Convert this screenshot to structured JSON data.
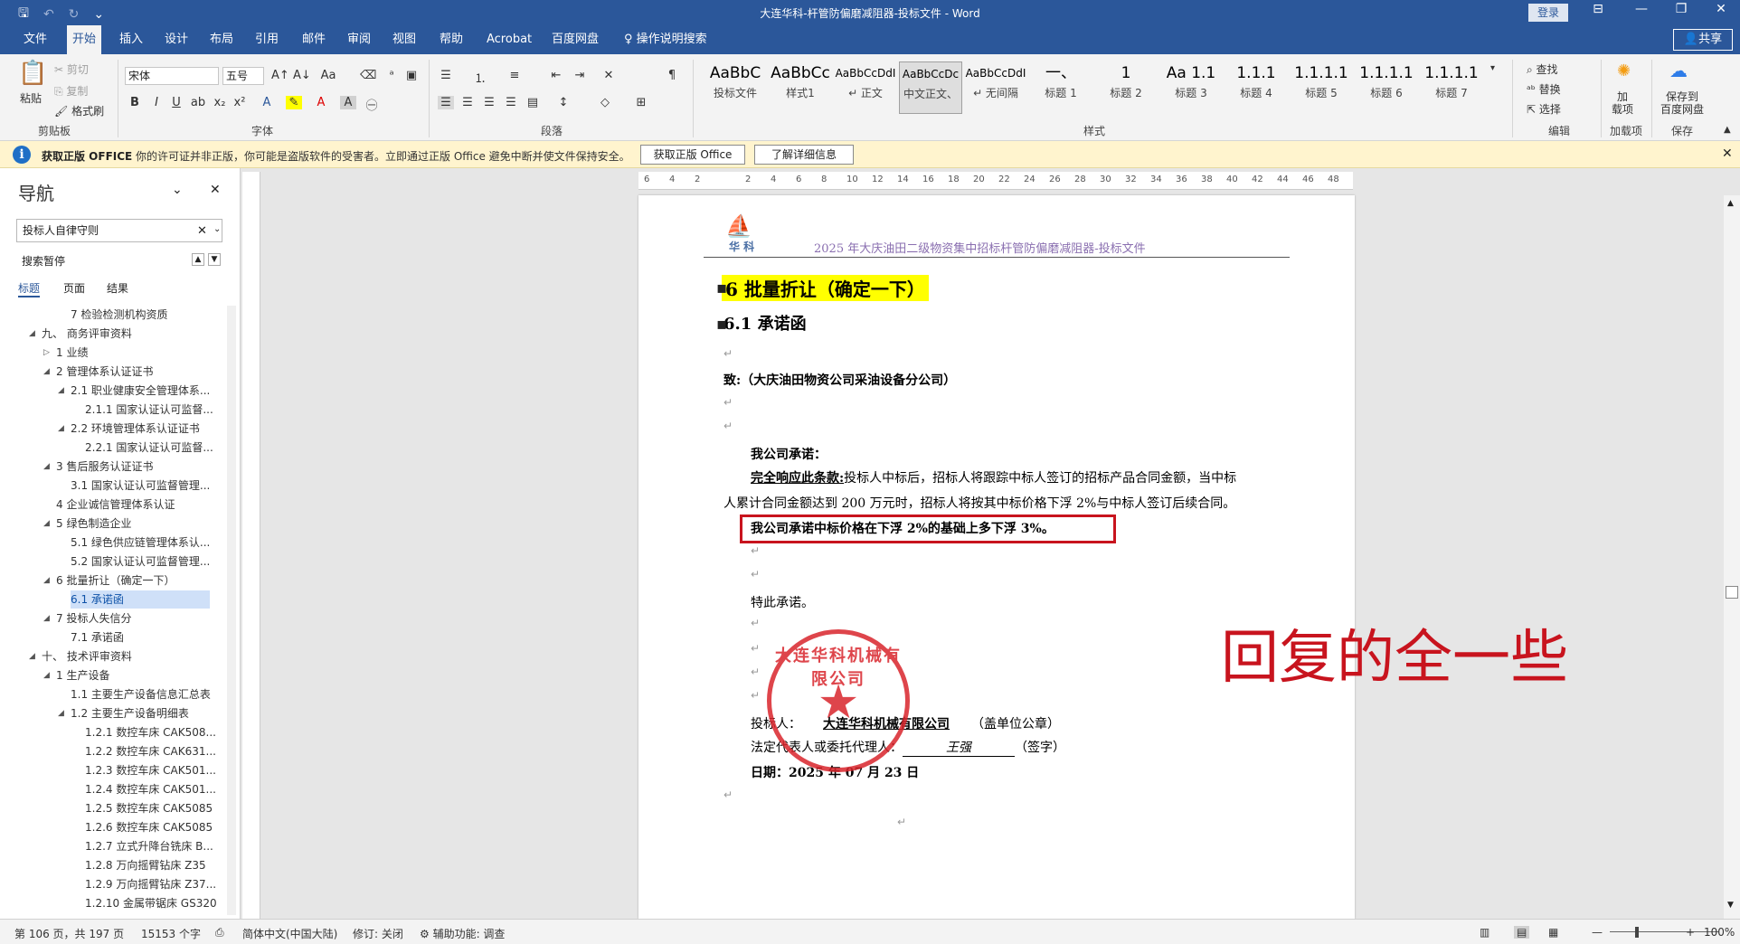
{
  "title_bar": {
    "title": "大连华科-杆管防偏磨减阻器-投标文件  -  Word",
    "login": "登录"
  },
  "tabs": [
    "文件",
    "开始",
    "插入",
    "设计",
    "布局",
    "引用",
    "邮件",
    "审阅",
    "视图",
    "帮助",
    "Acrobat",
    "百度网盘",
    "操作说明搜索"
  ],
  "active_tab": "开始",
  "share_label": "共享",
  "ribbon": {
    "clipboard": {
      "paste": "粘贴",
      "cut": "剪切",
      "copy": "复制",
      "format_painter": "格式刷",
      "label": "剪贴板"
    },
    "font": {
      "font_name": "宋体",
      "font_size": "五号",
      "label": "字体"
    },
    "paragraph": {
      "label": "段落"
    },
    "styles": {
      "label": "样式",
      "items": [
        {
          "sample": "AaBbC",
          "name": "投标文件"
        },
        {
          "sample": "AaBbCc",
          "name": "样式1"
        },
        {
          "sample": "AaBbCcDdI",
          "name": "↵ 正文"
        },
        {
          "sample": "AaBbCcDc",
          "name": "中文正文、"
        },
        {
          "sample": "AaBbCcDdI",
          "name": "↵ 无间隔"
        },
        {
          "sample": "一、",
          "name": "标题 1"
        },
        {
          "sample": "1",
          "name": "标题 2"
        },
        {
          "sample": "Aa 1.1",
          "name": "标题 3"
        },
        {
          "sample": "1.1.1",
          "name": "标题 4"
        },
        {
          "sample": "1.1.1.1",
          "name": "标题 5"
        },
        {
          "sample": "1.1.1.1",
          "name": "标题 6"
        },
        {
          "sample": "1.1.1.1",
          "name": "标题 7"
        }
      ]
    },
    "editing": {
      "find": "查找",
      "replace": "替换",
      "select": "选择",
      "label": "编辑"
    },
    "addins": {
      "item": "加\n载项",
      "label": "加载项"
    },
    "save": {
      "item": "保存到\n百度网盘",
      "label": "保存"
    }
  },
  "info_bar": {
    "heading": "获取正版 OFFICE",
    "message": "你的许可证并非正版，你可能是盗版软件的受害者。立即通过正版 Office 避免中断并使文件保持安全。",
    "button1": "获取正版 Office",
    "button2": "了解详细信息"
  },
  "nav": {
    "title": "导航",
    "search_value": "投标人自律守则",
    "paused": "搜索暂停",
    "tabs": [
      "标题",
      "页面",
      "结果"
    ],
    "items": [
      {
        "text": "7 检验检测机构资质",
        "indent": 3,
        "toggle": ""
      },
      {
        "text": "九、 商务评审资料",
        "indent": 1,
        "toggle": "◢"
      },
      {
        "text": "1 业绩",
        "indent": 2,
        "toggle": "▷"
      },
      {
        "text": "2 管理体系认证证书",
        "indent": 2,
        "toggle": "◢"
      },
      {
        "text": "2.1 职业健康安全管理体系...",
        "indent": 3,
        "toggle": "◢"
      },
      {
        "text": "2.1.1 国家认证认可监督...",
        "indent": 4,
        "toggle": ""
      },
      {
        "text": "2.2 环境管理体系认证证书",
        "indent": 3,
        "toggle": "◢"
      },
      {
        "text": "2.2.1 国家认证认可监督...",
        "indent": 4,
        "toggle": ""
      },
      {
        "text": "3 售后服务认证证书",
        "indent": 2,
        "toggle": "◢"
      },
      {
        "text": "3.1 国家认证认可监督管理...",
        "indent": 3,
        "toggle": ""
      },
      {
        "text": "4 企业诚信管理体系认证",
        "indent": 2,
        "toggle": ""
      },
      {
        "text": "5 绿色制造企业",
        "indent": 2,
        "toggle": "◢"
      },
      {
        "text": "5.1 绿色供应链管理体系认...",
        "indent": 3,
        "toggle": ""
      },
      {
        "text": "5.2 国家认证认可监督管理...",
        "indent": 3,
        "toggle": ""
      },
      {
        "text": "6 批量折让（确定一下）",
        "indent": 2,
        "toggle": "◢"
      },
      {
        "text": "6.1 承诺函",
        "indent": 3,
        "toggle": "",
        "selected": true
      },
      {
        "text": "7 投标人失信分",
        "indent": 2,
        "toggle": "◢"
      },
      {
        "text": "7.1 承诺函",
        "indent": 3,
        "toggle": ""
      },
      {
        "text": "十、 技术评审资料",
        "indent": 1,
        "toggle": "◢"
      },
      {
        "text": "1 生产设备",
        "indent": 2,
        "toggle": "◢"
      },
      {
        "text": "1.1 主要生产设备信息汇总表",
        "indent": 3,
        "toggle": ""
      },
      {
        "text": "1.2 主要生产设备明细表",
        "indent": 3,
        "toggle": "◢"
      },
      {
        "text": "1.2.1 数控车床 CAK508...",
        "indent": 4,
        "toggle": ""
      },
      {
        "text": "1.2.2 数控车床 CAK631...",
        "indent": 4,
        "toggle": ""
      },
      {
        "text": "1.2.3 数控车床 CAK501...",
        "indent": 4,
        "toggle": ""
      },
      {
        "text": "1.2.4 数控车床 CAK501...",
        "indent": 4,
        "toggle": ""
      },
      {
        "text": "1.2.5 数控车床 CAK5085",
        "indent": 4,
        "toggle": ""
      },
      {
        "text": "1.2.6 数控车床 CAK5085",
        "indent": 4,
        "toggle": ""
      },
      {
        "text": "1.2.7 立式升降台铣床 B...",
        "indent": 4,
        "toggle": ""
      },
      {
        "text": "1.2.8 万向摇臂钻床 Z35",
        "indent": 4,
        "toggle": ""
      },
      {
        "text": "1.2.9 万向摇臂钻床 Z37...",
        "indent": 4,
        "toggle": ""
      },
      {
        "text": "1.2.10 金属带锯床 GS320",
        "indent": 4,
        "toggle": ""
      }
    ]
  },
  "ruler": {
    "ticks": [
      "6",
      "4",
      "2",
      "",
      "2",
      "4",
      "6",
      "8",
      "10",
      "12",
      "14",
      "16",
      "18",
      "20",
      "22",
      "24",
      "26",
      "28",
      "30",
      "32",
      "34",
      "36",
      "38",
      "40",
      "42",
      "44",
      "46",
      "48"
    ]
  },
  "document": {
    "header_logo_text": "华 科",
    "header_text": "2025 年大庆油田二级物资集中招标杆管防偏磨减阻器-投标文件",
    "h1": "6    批量折让（确定一下）",
    "h2": "6.1  承诺函",
    "to": "致:（大庆油田物资公司采油设备分公司）",
    "promise_title": "我公司承诺：",
    "clause_bold": "完全响应此条款:",
    "clause_rest": "投标人中标后，招标人将跟踪中标人签订的招标产品合同金额，当中标",
    "clause_line2": "人累计合同金额达到 200 万元时，招标人将按其中标价格下浮 2%与中标人签订后续合同。",
    "boxed_text": "我公司承诺中标价格在下浮 2%的基础上多下浮 3%。",
    "special": "特此承诺。",
    "bidder_label": "投标人：",
    "bidder_value": "大连华科机械有限公司",
    "bidder_suffix": "（盖单位公章）",
    "rep_label": "法定代表人或委托代理人：",
    "rep_suffix": "（签字）",
    "signature": "王强",
    "date": "日期：2025 年 07 月 23 日",
    "seal_text": "大连华科机械有限公司"
  },
  "annotation": "回复的全一些",
  "status": {
    "page": "第 106 页，共 197 页",
    "words": "15153 个字",
    "lang": "简体中文(中国大陆)",
    "track": "修订: 关闭",
    "access": "辅助功能: 调查",
    "zoom": "100%"
  },
  "colors": {
    "accent": "#2b579a",
    "highlight": "#ffff00",
    "annotation_red": "#c8141e",
    "seal_red": "#d9252c"
  }
}
